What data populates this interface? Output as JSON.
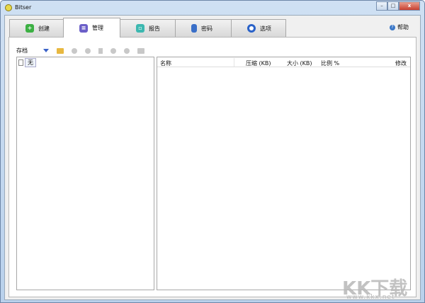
{
  "window": {
    "title": "Bitser",
    "minimize": "–",
    "maximize": "□",
    "close": "x"
  },
  "tabs": [
    {
      "label": "创建",
      "icon": "plus-icon",
      "color": "#3cb043"
    },
    {
      "label": "管理",
      "icon": "manage-icon",
      "color": "#6b5fc8"
    },
    {
      "label": "报告",
      "icon": "report-icon",
      "color": "#3cb8b0"
    },
    {
      "label": "密码",
      "icon": "key-icon",
      "color": "#3a6fc8"
    },
    {
      "label": "选项",
      "icon": "options-icon",
      "color": "#2a62c8"
    }
  ],
  "help": {
    "label": "帮助"
  },
  "toolbar": {
    "label": "存档"
  },
  "tree": {
    "items": [
      {
        "label": "无"
      }
    ]
  },
  "table": {
    "columns": [
      "名称",
      "压缩 (KB)",
      "大小 (KB)",
      "比例 %",
      "修改"
    ]
  },
  "watermark": {
    "logo": "KK下载",
    "url": "www.kkx.net"
  }
}
